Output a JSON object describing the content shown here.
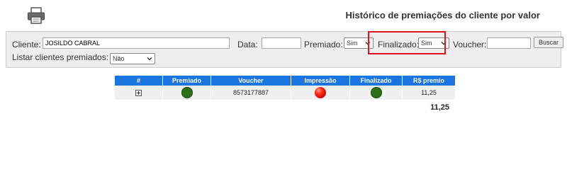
{
  "header": {
    "title": "Histórico de premiações do cliente por valor"
  },
  "filters": {
    "cliente_label": "Cliente:",
    "cliente_value": "JOSILDO CABRAL",
    "data_label": "Data:",
    "data_value": "",
    "premiado_label": "Premiado:",
    "premiado_value": "Sim",
    "finalizado_label": "Finalizado:",
    "finalizado_value": "Sim",
    "voucher_label": "Voucher:",
    "voucher_value": "",
    "buscar_label": "Buscar",
    "listar_label": "Listar clientes premiados:",
    "listar_value": "Não"
  },
  "table": {
    "headers": [
      "#",
      "Premiado",
      "Voucher",
      "Impressão",
      "Finalizado",
      "R$ premio"
    ],
    "rows": [
      {
        "expand_icon": "expand-plus-icon",
        "premiado": "green",
        "voucher": "8573177887",
        "impressao": "red",
        "finalizado": "green",
        "premio": "11,25"
      }
    ],
    "total": "11,25"
  },
  "colors": {
    "header_bg": "#1a75e0",
    "highlight_border": "#e0121d",
    "status_green": "#2d6f17",
    "status_red": "#ff2a18"
  }
}
